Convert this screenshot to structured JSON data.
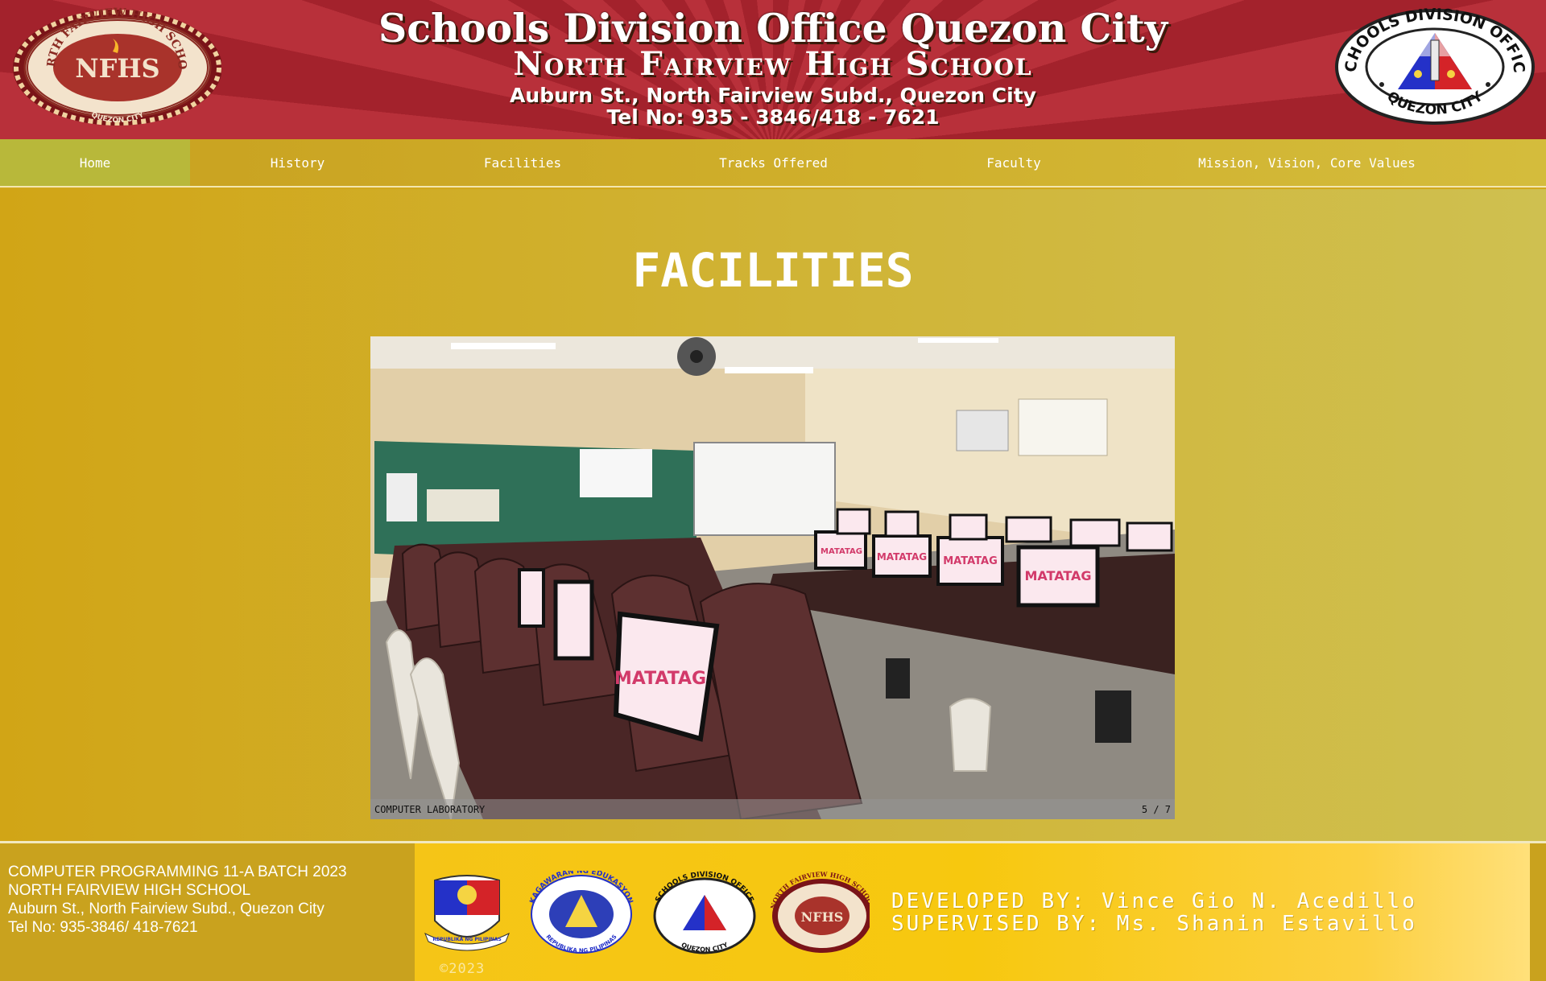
{
  "banner": {
    "line1": "Schools Division Office Quezon City",
    "line2": "North Fairview High School",
    "line3": "Auburn St., North Fairview Subd., Quezon City",
    "line4": "Tel No: 935 - 3846/418 - 7621",
    "left_seal_text": "NORTH FAIRVIEW HIGH SCHOOL",
    "left_seal_sub": "QUEZON CITY",
    "left_seal_mono": "NFHS",
    "right_seal_text": "SCHOOLS DIVISION OFFICE",
    "right_seal_sub": "QUEZON CITY"
  },
  "nav": {
    "items": [
      {
        "label": "Home",
        "active": true
      },
      {
        "label": "History",
        "active": false
      },
      {
        "label": "Facilities",
        "active": false
      },
      {
        "label": "Tracks Offered",
        "active": false
      },
      {
        "label": "Faculty",
        "active": false
      },
      {
        "label": "Mission, Vision, Core Values",
        "active": false
      }
    ]
  },
  "main": {
    "title": "FACILITIES",
    "slide": {
      "caption": "COMPUTER LABORATORY",
      "counter": "5 / 7",
      "monitor_text": "MATATAG"
    }
  },
  "footer": {
    "info_lines": [
      "COMPUTER PROGRAMMING 11-A BATCH 2023",
      "NORTH FAIRVIEW HIGH SCHOOL",
      "Auburn St., North Fairview Subd., Quezon City",
      "Tel No: 935-3846/ 418-7621"
    ],
    "developed_by": "DEVELOPED BY: Vince Gio N. Acedillo",
    "supervised_by": "SUPERVISED BY: Ms. Shanin Estavillo",
    "copyright": "©2023",
    "logos": [
      {
        "name": "philippine-seal",
        "text": "REPUBLIKA NG PILIPINAS"
      },
      {
        "name": "deped-seal",
        "text": "KAGAWARAN NG EDUKASYON",
        "sub": "REPUBLIKA NG PILIPINAS"
      },
      {
        "name": "sdo-seal",
        "text": "SCHOOLS DIVISION OFFICE",
        "sub": "QUEZON CITY"
      },
      {
        "name": "nfhs-seal",
        "text": "NORTH FAIRVIEW HIGH SCHOOL",
        "sub": "QUEZON CITY"
      }
    ]
  },
  "colors": {
    "banner_red": "#a3222c",
    "nav_gold": "#c8a01f",
    "nav_active": "#b8b83a",
    "main_gold": "#d1a516",
    "footer_yellow": "#f7c80f"
  }
}
